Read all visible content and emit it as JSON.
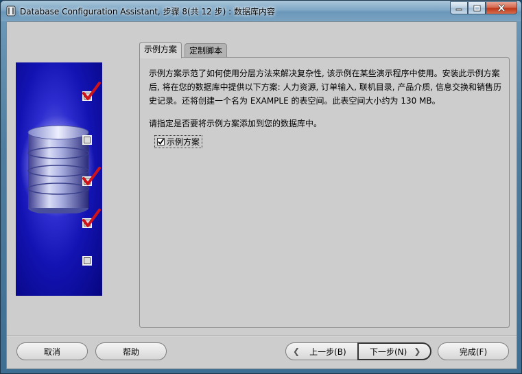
{
  "window": {
    "title": "Database Configuration Assistant, 步骤 8(共 12 步) : 数据库内容"
  },
  "tabs": [
    {
      "label": "示例方案",
      "active": true
    },
    {
      "label": "定制脚本",
      "active": false
    }
  ],
  "panel": {
    "description": "示例方案示范了如何使用分层方法来解决复杂性, 该示例在某些演示程序中使用。安装此示例方案后, 将在您的数据库中提供以下方案: 人力资源, 订单输入, 联机目录, 产品介质, 信息交换和销售历史记录。还将创建一个名为 EXAMPLE 的表空间。此表空间大小约为 130 MB。",
    "prompt": "请指定是否要将示例方案添加到您的数据库中。",
    "checkbox_label": "示例方案",
    "checkbox_checked": true
  },
  "side_steps": [
    {
      "checked": true
    },
    {
      "checked": false
    },
    {
      "checked": true
    },
    {
      "checked": true
    },
    {
      "checked": false
    }
  ],
  "buttons": {
    "cancel": "取消",
    "help": "帮助",
    "back": "上一步(B)",
    "next": "下一步(N)",
    "finish": "完成(F)"
  },
  "colors": {
    "accent_check": "#d0131b",
    "side_panel_blue": "#1313b3"
  }
}
